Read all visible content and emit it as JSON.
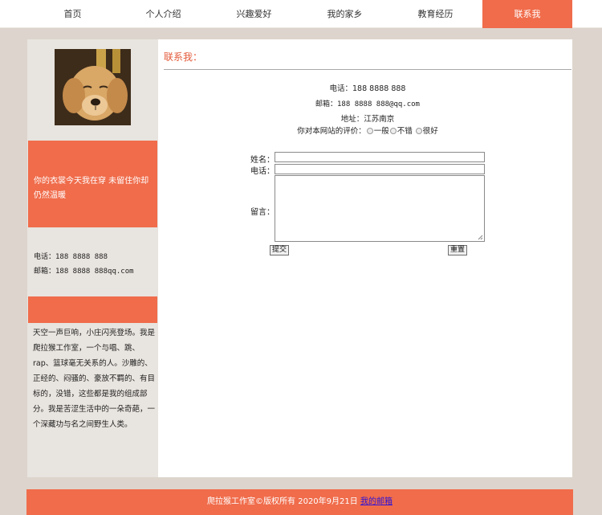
{
  "nav": {
    "items": [
      "首页",
      "个人介绍",
      "兴趣爱好",
      "我的家乡",
      "教育经历",
      "联系我"
    ],
    "active_index": 5
  },
  "sidebar": {
    "quote": "你的衣裳今天我在穿  未留住你却仍然温暖",
    "phone": "电话：188 8888 888",
    "email": "邮箱：188 8888 888qq.com",
    "intro": "天空一声巨响，小庄闪亮登场。我是爬拉猴工作室，一个与唱、跳、rap、篮球毫无关系的人。沙雕的、正经的、闷骚的、豪放不羁的、有目标的，没错，这些都是我的组成部分。我是苦涩生活中的一朵奇葩，一个深藏功与名之间野生人类。"
  },
  "content": {
    "title": "联系我：",
    "phone": "电话：188 8888 888",
    "email": "邮箱：188 8888 888@qq.com",
    "address": "地址：江苏南京",
    "rating_label": "你对本网站的评价：",
    "rating_options": [
      "一般",
      "不错",
      "很好"
    ]
  },
  "form": {
    "name_label": "姓名：",
    "phone_label": "电话：",
    "message_label": "留言：",
    "name_value": "",
    "phone_value": "",
    "message_value": "",
    "submit_label": "提交",
    "reset_label": "重置"
  },
  "footer": {
    "text": "爬拉猴工作室©版权所有  2020年9月21日",
    "link": "我的邮箱"
  },
  "colors": {
    "accent": "#f06c4b",
    "background": "#ddd5cd",
    "sidebar": "#e8e4df",
    "title": "#e35a3a",
    "link": "#2b12d8"
  }
}
